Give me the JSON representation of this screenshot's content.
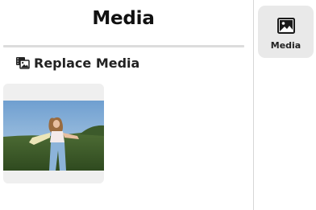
{
  "panel": {
    "title": "Media",
    "replace_label": "Replace Media",
    "replace_icon": "replace-media-icon",
    "thumbnail": {
      "alt": "media-thumbnail"
    }
  },
  "rail": {
    "items": [
      {
        "label": "Media",
        "icon": "image-icon",
        "selected": true
      }
    ]
  },
  "colors": {
    "rail_selected_bg": "#e9e9e9",
    "card_bg": "#efefef",
    "divider": "#dcdcdc"
  }
}
